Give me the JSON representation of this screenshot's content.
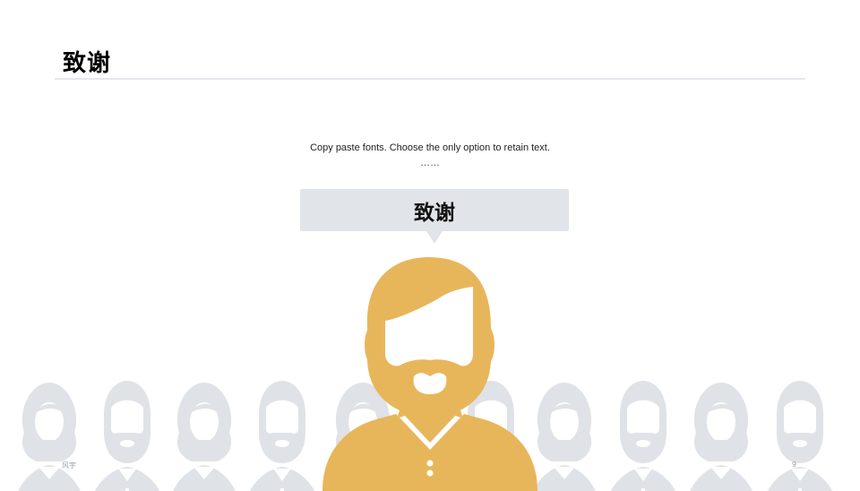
{
  "slide": {
    "title": "致谢",
    "subtitle": "Copy paste fonts. Choose the only option to retain text.",
    "ellipsis": "……",
    "bubble_text": "致谢",
    "footer_left": "风宇",
    "page_number": "9"
  },
  "colors": {
    "accent_person": "#e8b65a",
    "crowd": "#dfe2e7",
    "bubble": "#e1e4e9",
    "rule": "#e6e8ec"
  },
  "icons": {
    "main": "bearded-man-icon",
    "crowd": "person-silhouette-icon"
  }
}
